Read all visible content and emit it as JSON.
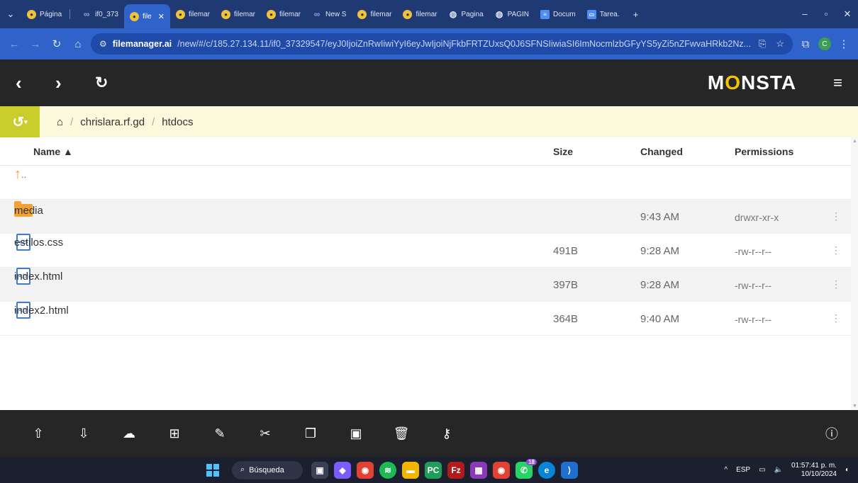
{
  "browser": {
    "tabs": [
      {
        "label": "Página",
        "icon": "monsta-icon",
        "active": false
      },
      {
        "label": "if0_373",
        "icon": "infinity-icon",
        "active": false
      },
      {
        "label": "file",
        "icon": "monsta-icon",
        "active": true
      },
      {
        "label": "filemar",
        "icon": "monsta-icon",
        "active": false
      },
      {
        "label": "filemar",
        "icon": "monsta-icon",
        "active": false
      },
      {
        "label": "filemar",
        "icon": "monsta-icon",
        "active": false
      },
      {
        "label": "New S",
        "icon": "infinity-icon",
        "active": false
      },
      {
        "label": "filemar",
        "icon": "monsta-icon",
        "active": false
      },
      {
        "label": "filemar",
        "icon": "monsta-icon",
        "active": false
      },
      {
        "label": "Pagina",
        "icon": "globe-icon",
        "active": false
      },
      {
        "label": "PAGIN",
        "icon": "globe-icon",
        "active": false
      },
      {
        "label": "Docum",
        "icon": "docs-icon",
        "active": false
      },
      {
        "label": "Tarea.",
        "icon": "slides-icon",
        "active": false
      }
    ],
    "url_host": "filemanager.ai",
    "url_rest": "/new/#/c/185.27.134.11/if0_37329547/eyJ0IjoiZnRwIiwiYyI6eyJwIjoiNjFkbFRTZUxsQ0J6SFNSIiwiaSI6ImNocmlzbGFyYS5yZi5nZFwvaHRkb2Nz...",
    "profile_initial": "C"
  },
  "app": {
    "logo_prefix": "M",
    "logo_o": "O",
    "logo_suffix": "NSTA"
  },
  "breadcrumb": {
    "items": [
      "chrislara.rf.gd",
      "htdocs"
    ]
  },
  "table": {
    "headers": {
      "name": "Name ▲",
      "size": "Size",
      "changed": "Changed",
      "permissions": "Permissions"
    },
    "parent": "..",
    "rows": [
      {
        "name": "media",
        "type": "folder",
        "size": "",
        "changed": "9:43 AM",
        "permissions": "drwxr-xr-x"
      },
      {
        "name": "estilos.css",
        "type": "code",
        "size": "491B",
        "changed": "9:28 AM",
        "permissions": "-rw-r--r--"
      },
      {
        "name": "index.html",
        "type": "code",
        "size": "397B",
        "changed": "9:28 AM",
        "permissions": "-rw-r--r--"
      },
      {
        "name": "index2.html",
        "type": "code",
        "size": "364B",
        "changed": "9:40 AM",
        "permissions": "-rw-r--r--"
      }
    ]
  },
  "taskbar": {
    "search_label": "Búsqueda",
    "language": "ESP",
    "time": "01:57:41 p. m.",
    "date": "10/10/2024",
    "badge_count": "18"
  },
  "colors": {
    "accent_blue": "#2f63c9",
    "header_dark": "#262626",
    "breadcrumb_bg": "#fbf8dc",
    "history_btn": "#c9ce2c",
    "folder": "#f4a233"
  }
}
